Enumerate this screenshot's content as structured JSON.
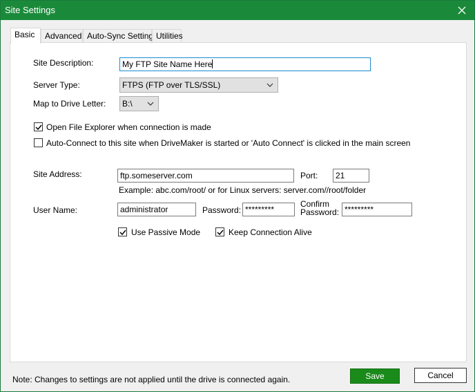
{
  "window": {
    "title": "Site Settings",
    "close_icon": "close-icon"
  },
  "tabs": [
    {
      "label": "Basic",
      "active": true
    },
    {
      "label": "Advanced",
      "active": false
    },
    {
      "label": "Auto-Sync Settings",
      "active": false
    },
    {
      "label": "Utilities",
      "active": false
    }
  ],
  "basic": {
    "site_description": {
      "label": "Site Description:",
      "value": "My FTP Site Name Here"
    },
    "server_type": {
      "label": "Server Type:",
      "value": "FTPS (FTP over TLS/SSL)"
    },
    "drive_letter": {
      "label": "Map to Drive Letter:",
      "value": "B:\\"
    },
    "open_explorer": {
      "label": "Open File Explorer when connection is made",
      "checked": true
    },
    "auto_connect": {
      "label": "Auto-Connect to this site when DriveMaker is started or 'Auto Connect' is clicked in the main screen",
      "checked": false
    },
    "site_address": {
      "label": "Site Address:",
      "value": "ftp.someserver.com"
    },
    "port": {
      "label": "Port:",
      "value": "21"
    },
    "example": "Example: abc.com/root/ or for Linux servers: server.com//root/folder",
    "user_name": {
      "label": "User Name:",
      "value": "administrator"
    },
    "password": {
      "label": "Password:",
      "value": "*********"
    },
    "confirm_password": {
      "label_line1": "Confirm",
      "label_line2": "Password:",
      "value": "*********"
    },
    "passive_mode": {
      "label": "Use Passive Mode",
      "checked": true
    },
    "keep_alive": {
      "label": "Keep Connection Alive",
      "checked": true
    }
  },
  "footer": {
    "note": "Note: Changes to settings are not applied until the drive is connected again.",
    "save_label": "Save",
    "cancel_label": "Cancel"
  },
  "colors": {
    "titlebar": "#1a8a3a",
    "save_button": "#1a8a1a",
    "focus_border": "#1a8ad4"
  }
}
